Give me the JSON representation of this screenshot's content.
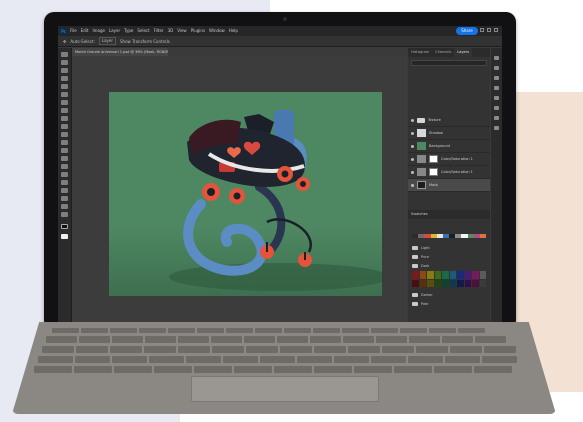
{
  "app": {
    "logo": "Ps",
    "menu": [
      "File",
      "Edit",
      "Image",
      "Layer",
      "Type",
      "Select",
      "Filter",
      "3D",
      "View",
      "Plugins",
      "Window",
      "Help"
    ],
    "share_label": "Share"
  },
  "options_bar": {
    "items": [
      "Auto-Select:",
      "Layer",
      "Show Transform Controls"
    ]
  },
  "document": {
    "tab_title": "Monte Grande Aniversari 1.psd @ 36% (Mask, RGB/8*) ×"
  },
  "panels": {
    "tabs": [
      "Histogram",
      "Channels",
      "Layers"
    ],
    "active_tab": "Layers",
    "layers": [
      {
        "name": "Texture",
        "kind": "folder"
      },
      {
        "name": "Shadow",
        "kind": "layer"
      },
      {
        "name": "Background",
        "kind": "layer"
      },
      {
        "name": "Color/Saturation 1",
        "kind": "adjustment"
      },
      {
        "name": "Color/Saturation 1",
        "kind": "adjustment"
      },
      {
        "name": "Mask",
        "kind": "mask",
        "selected": true
      }
    ],
    "swatches_title": "Swatches",
    "swatch_groups": [
      "Light",
      "Pure",
      "Dark",
      "Darker",
      "Pale"
    ],
    "colors": {
      "strip": [
        "#2b2b2b",
        "#6b6b6b",
        "#d94a3a",
        "#e3b13b",
        "#e6e6e6",
        "#3a6fb4",
        "#1f1f1f",
        "#8c8c8c",
        "#f4f4f4",
        "#5a8a5a",
        "#b04a8a",
        "#e07040"
      ],
      "dark_row1": [
        "#7a1a1a",
        "#8a4a12",
        "#8a7a12",
        "#3a6a1a",
        "#1a6a4a",
        "#1a5a7a",
        "#1a2a7a",
        "#4a1a7a",
        "#7a1a5a",
        "#5a5a5a"
      ],
      "dark_row2": [
        "#4a0e0e",
        "#5a300c",
        "#5a4e0c",
        "#24440e",
        "#0e4430",
        "#0e3a50",
        "#0e1a50",
        "#300e50",
        "#500e3a",
        "#3a3a3a"
      ]
    }
  }
}
